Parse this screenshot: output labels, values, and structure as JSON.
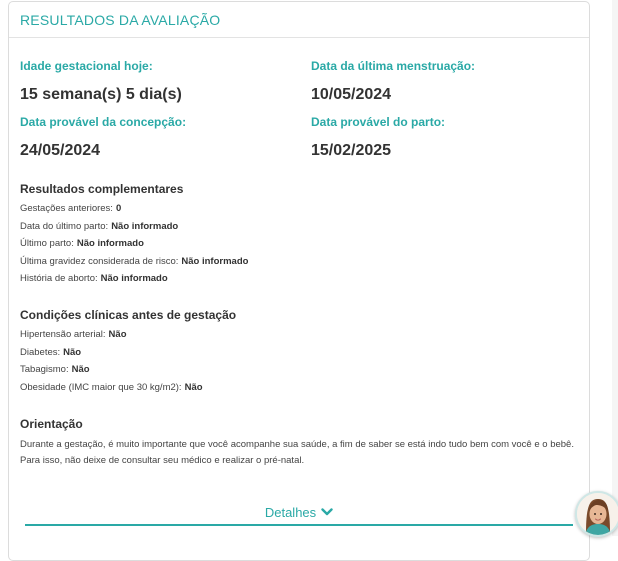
{
  "card": {
    "title": "RESULTADOS DA AVALIAÇÃO"
  },
  "summary": {
    "gestational_age_label": "Idade gestacional hoje:",
    "gestational_age_value": "15 semana(s) 5 dia(s)",
    "last_period_label": "Data da última menstruação:",
    "last_period_value": "10/05/2024",
    "conception_label": "Data provável da concepção:",
    "conception_value": "24/05/2024",
    "due_date_label": "Data provável do parto:",
    "due_date_value": "15/02/2025"
  },
  "complementary": {
    "title": "Resultados complementares",
    "items": [
      {
        "label": "Gestações anteriores:",
        "value": "0"
      },
      {
        "label": "Data do último parto:",
        "value": "Não informado"
      },
      {
        "label": "Último parto:",
        "value": "Não informado"
      },
      {
        "label": "Última gravidez considerada de risco:",
        "value": "Não informado"
      },
      {
        "label": "História de aborto:",
        "value": "Não informado"
      }
    ]
  },
  "clinical": {
    "title": "Condições clínicas antes de gestação",
    "items": [
      {
        "label": "Hipertensão arterial:",
        "value": "Não"
      },
      {
        "label": "Diabetes:",
        "value": "Não"
      },
      {
        "label": "Tabagismo:",
        "value": "Não"
      },
      {
        "label": "Obesidade (IMC maior que 30 kg/m2):",
        "value": "Não"
      }
    ]
  },
  "orientation": {
    "title": "Orientação",
    "text": "Durante a gestação, é muito importante que você acompanhe sua saúde, a fim de saber se está indo tudo bem com você e o bebê. Para isso, não deixe de consultar seu médico e realizar o pré-natal."
  },
  "details": {
    "label": "Detalhes",
    "icon": "chevron-down-icon"
  },
  "assistant": {
    "icon": "assistant-avatar-icon"
  },
  "colors": {
    "accent": "#2aa9a6",
    "text": "#333333",
    "border": "#dcdcdc"
  }
}
